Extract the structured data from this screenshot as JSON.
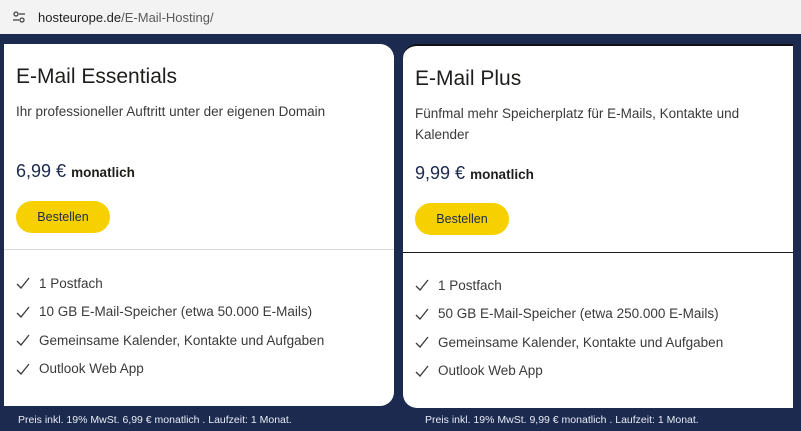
{
  "browser": {
    "url_host": "hosteurope.de",
    "url_path": "/E-Mail-Hosting/",
    "site_icon": "tune-icon"
  },
  "plans": [
    {
      "name": "E-Mail Essentials",
      "subtitle": "Ihr professioneller Auftritt unter der eigenen Domain",
      "price": "6,99 €",
      "period": "monatlich",
      "button": "Bestellen",
      "features": [
        "1 Postfach",
        "10 GB E-Mail-Speicher (etwa 50.000 E-Mails)",
        "Gemeinsame Kalender, Kontakte und Aufgaben",
        "Outlook Web App"
      ],
      "footer": "Preis inkl. 19% MwSt. 6,99 € monatlich . Laufzeit: 1 Monat."
    },
    {
      "name": "E-Mail Plus",
      "subtitle": "Fünfmal mehr Speicherplatz für E-Mails, Kontakte und Kalender",
      "price": "9,99 €",
      "period": "monatlich",
      "button": "Bestellen",
      "features": [
        "1 Postfach",
        "50 GB E-Mail-Speicher (etwa 250.000 E-Mails)",
        "Gemeinsame Kalender, Kontakte und Aufgaben",
        "Outlook Web App"
      ],
      "footer": "Preis inkl. 19% MwSt. 9,99 € monatlich . Laufzeit: 1 Monat."
    }
  ],
  "colors": {
    "navy": "#1b2a4e",
    "button_yellow": "#f7d000"
  }
}
